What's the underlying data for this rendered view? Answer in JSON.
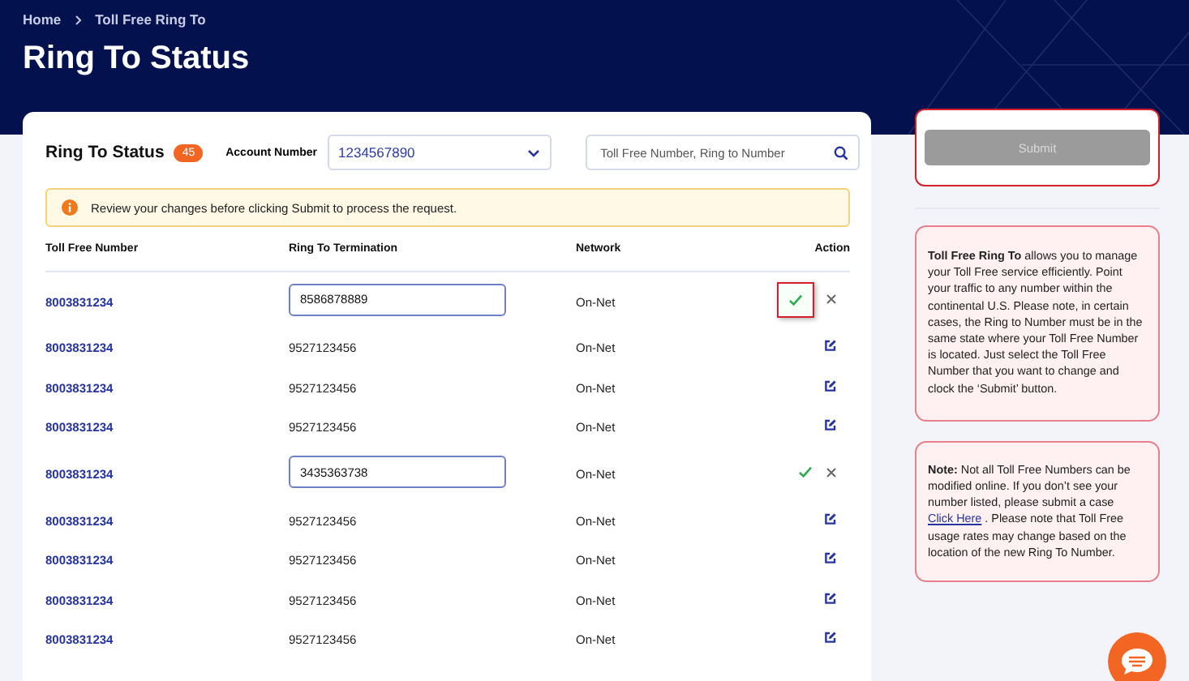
{
  "breadcrumbs": [
    {
      "label": "Home"
    },
    {
      "label": "Toll Free Ring To"
    }
  ],
  "page_title": "Ring To Status",
  "panel": {
    "title": "Ring To Status",
    "count": "45",
    "account_label": "Account Number",
    "account_value": "1234567890",
    "search_placeholder": "Toll Free Number, Ring to Number",
    "alert": "Review your changes before clicking Submit to process the request."
  },
  "table": {
    "columns": [
      "Toll Free Number",
      "Ring To Termination",
      "Network",
      "Action"
    ],
    "rows": [
      {
        "kind": "editing",
        "number": "8003831234",
        "termination": "8586878889",
        "network": "On-Net",
        "highlighted": true
      },
      {
        "kind": "view",
        "number": "8003831234",
        "termination": "9527123456",
        "network": "On-Net"
      },
      {
        "kind": "view",
        "number": "8003831234",
        "termination": "9527123456",
        "network": "On-Net"
      },
      {
        "kind": "view",
        "number": "8003831234",
        "termination": "9527123456",
        "network": "On-Net"
      },
      {
        "kind": "editing",
        "number": "8003831234",
        "termination": "3435363738",
        "network": "On-Net",
        "highlighted": false
      },
      {
        "kind": "view",
        "number": "8003831234",
        "termination": "9527123456",
        "network": "On-Net"
      },
      {
        "kind": "view",
        "number": "8003831234",
        "termination": "9527123456",
        "network": "On-Net"
      },
      {
        "kind": "view",
        "number": "8003831234",
        "termination": "9527123456",
        "network": "On-Net"
      },
      {
        "kind": "view",
        "number": "8003831234",
        "termination": "9527123456",
        "network": "On-Net"
      }
    ]
  },
  "submit": {
    "label": "Submit",
    "disabled": true,
    "highlighted": true
  },
  "info": "**Toll Free Ring To** allows you to manage your Toll Free service efficiently. Point your traffic to any number within the continental U.S. Please note, in certain cases, the Ring to Number must be in the same state where your Toll Free Number is located. Just select the Toll Free Number that you want to change and clock the ‘Submit’ button.",
  "note": {
    "before": "**Note:**  Not all Toll Free Numbers can be modified online.  If you don’t see your number listed, please submit a case ",
    "link": "Click Here",
    "after": " .  Please note that Toll Free usage rates may change based on the location of the new Ring To Number."
  }
}
